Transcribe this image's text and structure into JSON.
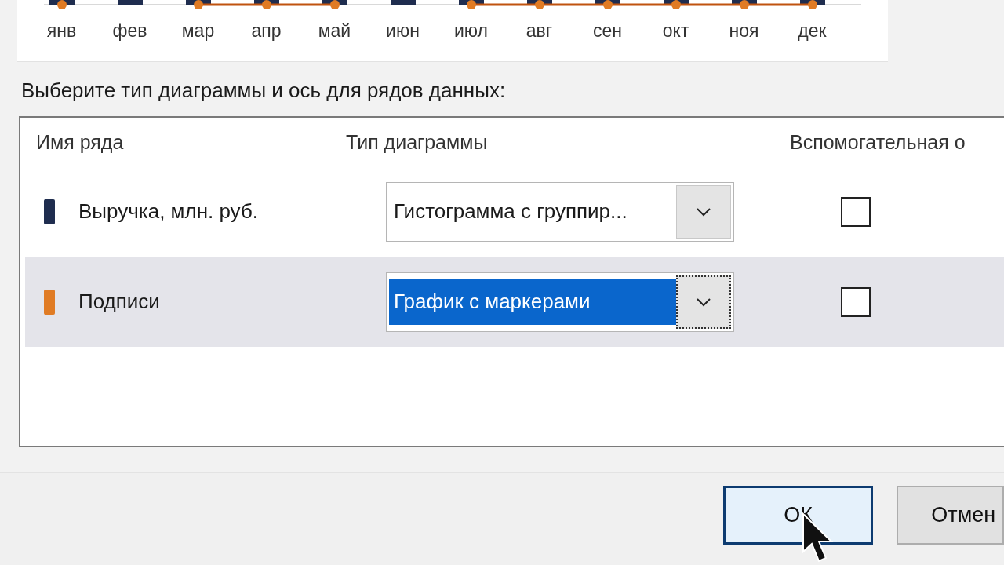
{
  "chart_preview": {
    "months": [
      "янв",
      "фев",
      "мар",
      "апр",
      "май",
      "июн",
      "июл",
      "авг",
      "сен",
      "окт",
      "ноя",
      "дек"
    ]
  },
  "prompt": "Выберите тип диаграммы и ось для рядов данных:",
  "series_table": {
    "columns": [
      "Имя ряда",
      "Тип диаграммы",
      "Вспомогательная о"
    ],
    "rows": [
      {
        "name": "Выручка, млн. руб.",
        "color": "#1f2d4f",
        "chart_type": "Гистограмма с группир...",
        "secondary_axis": false,
        "selected": false
      },
      {
        "name": "Подписи",
        "color": "#e07b24",
        "chart_type": "График с маркерами",
        "secondary_axis": false,
        "selected": true
      }
    ]
  },
  "buttons": [
    {
      "label": "ОК",
      "kind": "default"
    },
    {
      "label": "Отмен",
      "kind": "normal"
    }
  ]
}
